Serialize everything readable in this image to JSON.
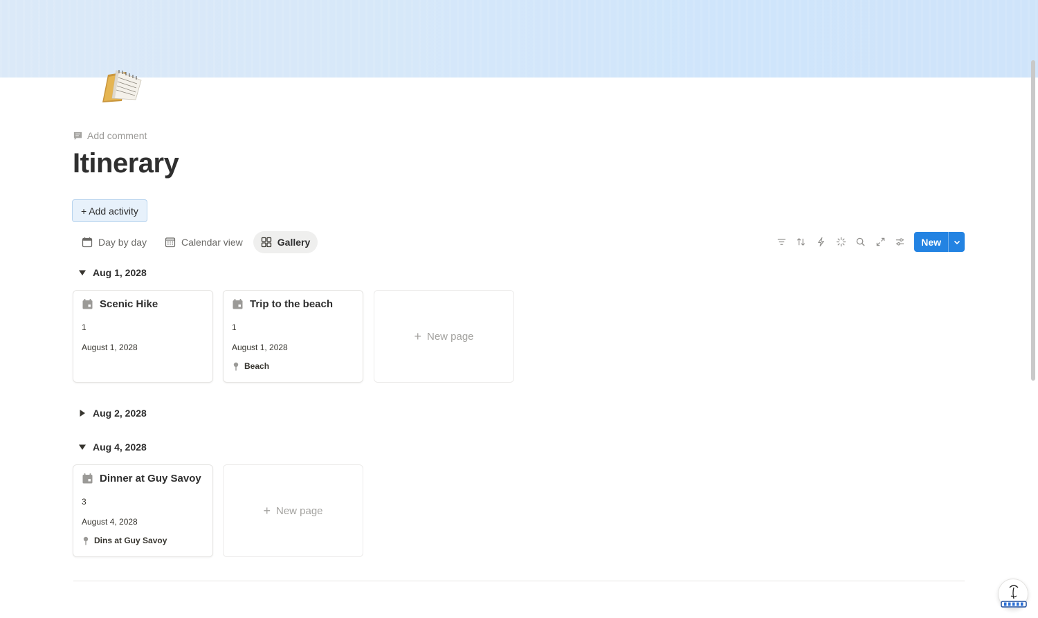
{
  "add_comment_label": "Add comment",
  "title": "Itinerary",
  "add_activity_label": "+ Add activity",
  "views": [
    {
      "label": "Day by day",
      "icon": "calendar-icon"
    },
    {
      "label": "Calendar view",
      "icon": "calendar-grid-icon"
    },
    {
      "label": "Gallery",
      "icon": "gallery-icon",
      "active": true
    }
  ],
  "toolbar": {
    "icons": [
      "filter-icon",
      "sort-icon",
      "lightning-icon",
      "sparkle-icon",
      "search-icon",
      "expand-icon",
      "settings-sliders-icon"
    ],
    "new_label": "New"
  },
  "groups": [
    {
      "label": "Aug 1, 2028",
      "expanded": true,
      "cards": [
        {
          "title": "Scenic Hike",
          "day": "1",
          "date": "August 1, 2028",
          "location": ""
        },
        {
          "title": "Trip to the beach",
          "day": "1",
          "date": "August 1, 2028",
          "location": "Beach"
        }
      ],
      "new_page_label": "New page"
    },
    {
      "label": "Aug 2, 2028",
      "expanded": false
    },
    {
      "label": "Aug 4, 2028",
      "expanded": true,
      "cards": [
        {
          "title": "Dinner at Guy Savoy",
          "day": "3",
          "date": "August 4, 2028",
          "location": "Dins at Guy Savoy"
        }
      ],
      "new_page_label": "New page"
    }
  ],
  "colors": {
    "accent": "#2383e2",
    "add_activity_bg": "#e7f1fb",
    "cover": "#d7e8f9"
  }
}
